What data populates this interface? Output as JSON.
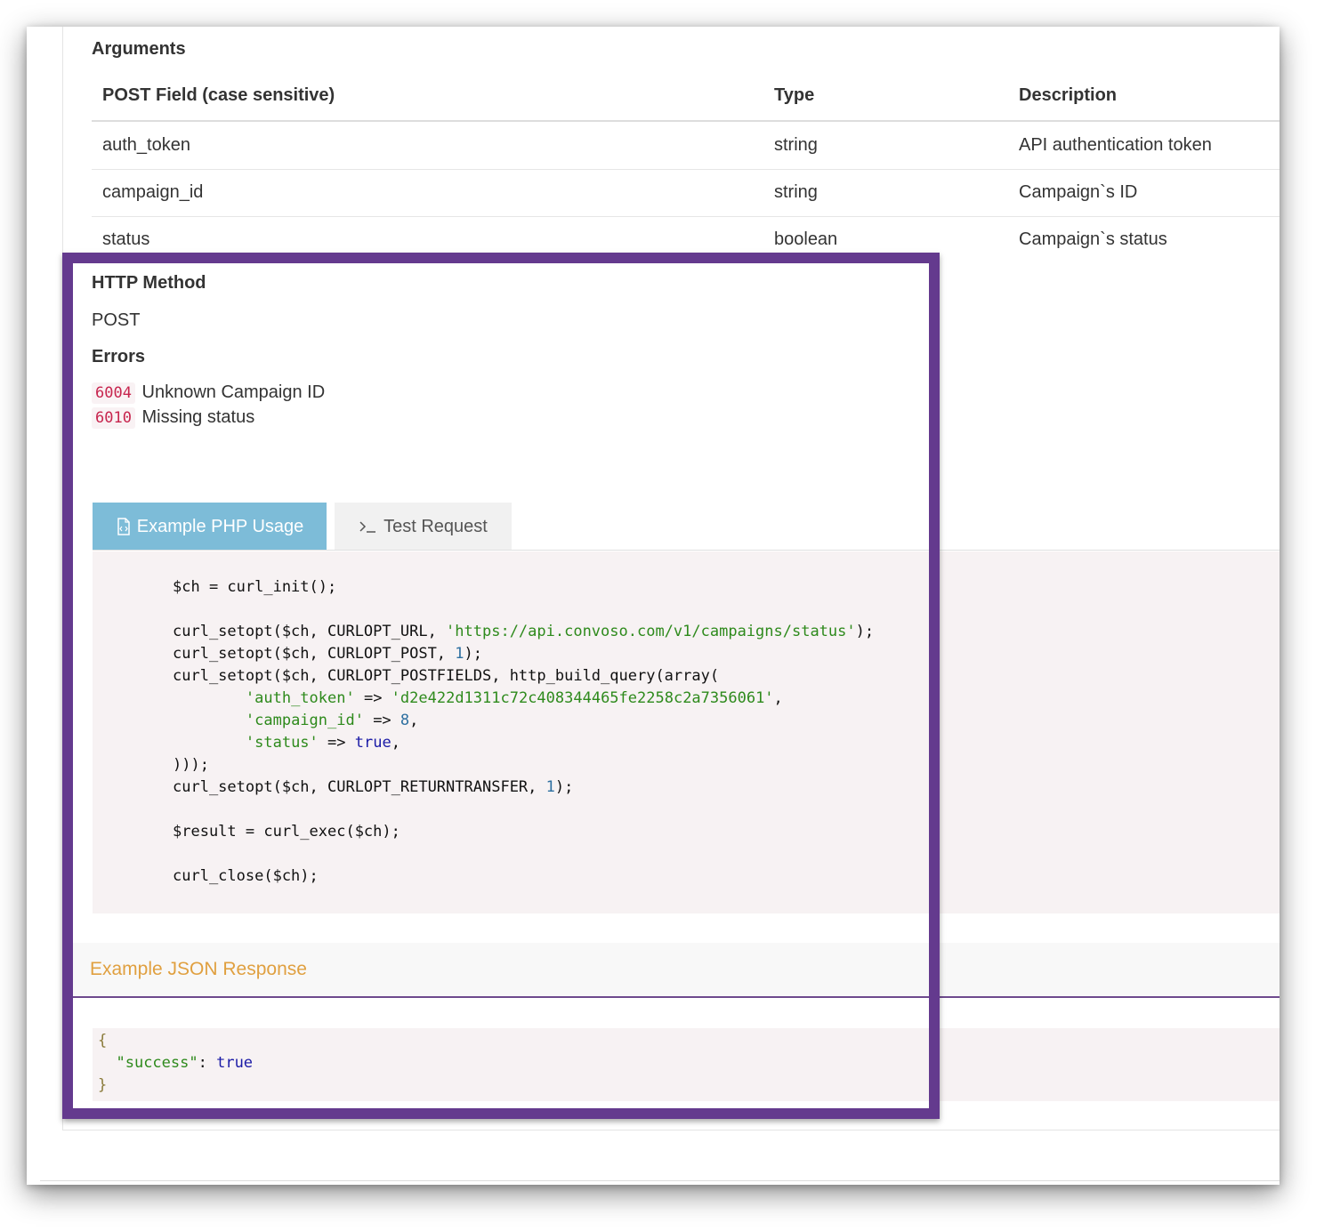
{
  "arguments": {
    "heading": "Arguments",
    "columns": {
      "field": "POST Field (case sensitive)",
      "type": "Type",
      "description": "Description"
    },
    "rows": [
      {
        "field": "auth_token",
        "type": "string",
        "description": "API authentication token"
      },
      {
        "field": "campaign_id",
        "type": "string",
        "description": "Campaign`s ID"
      },
      {
        "field": "status",
        "type": "boolean",
        "description": "Campaign`s status"
      }
    ]
  },
  "http_method": {
    "heading": "HTTP Method",
    "value": "POST"
  },
  "errors": {
    "heading": "Errors",
    "items": [
      {
        "code": "6004",
        "message": "Unknown Campaign ID"
      },
      {
        "code": "6010",
        "message": "Missing status"
      }
    ]
  },
  "tabs": [
    {
      "label": "Example PHP Usage",
      "icon": "file-code-icon",
      "active": true
    },
    {
      "label": "Test Request",
      "icon": "terminal-icon",
      "active": false
    }
  ],
  "code": {
    "l1": "$ch = curl_init();",
    "l2a": "curl_setopt($ch, CURLOPT_URL, ",
    "l2b": "'https://api.convoso.com/v1/campaigns/status'",
    "l2c": ");",
    "l3a": "curl_setopt($ch, CURLOPT_POST, ",
    "l3b": "1",
    "l3c": ");",
    "l4": "curl_setopt($ch, CURLOPT_POSTFIELDS, http_build_query(array(",
    "l5a": "'auth_token'",
    "l5b": " => ",
    "l5c": "'d2e422d1311c72c408344465fe2258c2a7356061'",
    "l5d": ",",
    "l6a": "'campaign_id'",
    "l6b": " => ",
    "l6c": "8",
    "l6d": ",",
    "l7a": "'status'",
    "l7b": " => ",
    "l7c": "true",
    "l7d": ",",
    "l8": ")));",
    "l9a": "curl_setopt($ch, CURLOPT_RETURNTRANSFER, ",
    "l9b": "1",
    "l9c": ");",
    "l10": "$result = curl_exec($ch);",
    "l11": "curl_close($ch);"
  },
  "json_response": {
    "title": "Example JSON Response",
    "open": "{",
    "key": "\"success\"",
    "colon": ": ",
    "value": "true",
    "close": "}"
  },
  "colors": {
    "highlight_border": "#643a8e",
    "active_tab": "#7dbcd8",
    "json_title": "#e0a040",
    "error_code": "#c7254e"
  }
}
